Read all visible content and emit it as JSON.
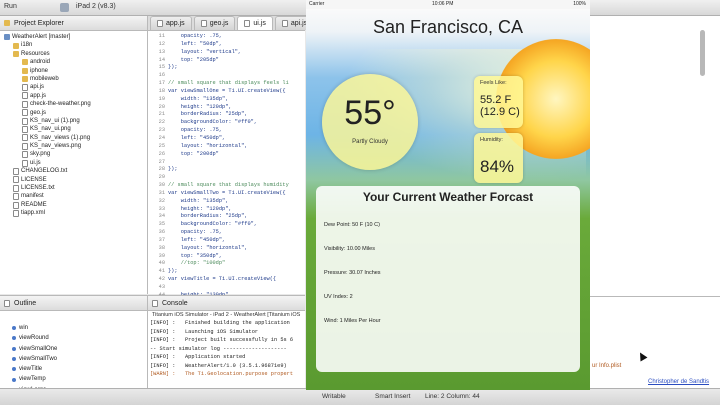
{
  "toolbar": {
    "run_label": "Run",
    "device_label": "iPad 2 (v8.3)"
  },
  "explorer": {
    "title": "Project Explorer",
    "items": [
      {
        "label": "WeatherAlert [master]",
        "icon": "project-icon",
        "indent": 0
      },
      {
        "label": "i18n",
        "icon": "folder-icon",
        "indent": 1
      },
      {
        "label": "Resources",
        "icon": "folder-icon",
        "indent": 1
      },
      {
        "label": "android",
        "icon": "folder-icon",
        "indent": 2
      },
      {
        "label": "iphone",
        "icon": "folder-icon",
        "indent": 2
      },
      {
        "label": "mobileweb",
        "icon": "folder-icon",
        "indent": 2
      },
      {
        "label": "api.js",
        "icon": "file-icon",
        "indent": 2
      },
      {
        "label": "app.js",
        "icon": "file-icon",
        "indent": 2
      },
      {
        "label": "check-the-weather.png",
        "icon": "file-icon",
        "indent": 2
      },
      {
        "label": "geo.js",
        "icon": "file-icon",
        "indent": 2
      },
      {
        "label": "KS_nav_ui (1).png",
        "icon": "file-icon",
        "indent": 2
      },
      {
        "label": "KS_nav_ui.png",
        "icon": "file-icon",
        "indent": 2
      },
      {
        "label": "KS_nav_views (1).png",
        "icon": "file-icon",
        "indent": 2
      },
      {
        "label": "KS_nav_views.png",
        "icon": "file-icon",
        "indent": 2
      },
      {
        "label": "sky.png",
        "icon": "file-icon",
        "indent": 2
      },
      {
        "label": "ui.js",
        "icon": "file-icon",
        "indent": 2
      },
      {
        "label": "CHANGELOG.txt",
        "icon": "file-icon",
        "indent": 1
      },
      {
        "label": "LICENSE",
        "icon": "file-icon",
        "indent": 1
      },
      {
        "label": "LICENSE.txt",
        "icon": "file-icon",
        "indent": 1
      },
      {
        "label": "manifest",
        "icon": "file-icon",
        "indent": 1
      },
      {
        "label": "README",
        "icon": "file-icon",
        "indent": 1
      },
      {
        "label": "tiapp.xml",
        "icon": "file-icon",
        "indent": 1
      }
    ]
  },
  "editor": {
    "tabs": [
      {
        "label": "app.js",
        "active": false
      },
      {
        "label": "geo.js",
        "active": false
      },
      {
        "label": "ui.js",
        "active": true
      },
      {
        "label": "api.js",
        "active": false
      }
    ],
    "lines": [
      {
        "n": "11",
        "t": "    opacity: .75,",
        "k": ""
      },
      {
        "n": "12",
        "t": "    left: \"50dp\",",
        "k": ""
      },
      {
        "n": "13",
        "t": "    layout: \"vertical\",",
        "k": ""
      },
      {
        "n": "14",
        "t": "    top: \"205dp\"",
        "k": ""
      },
      {
        "n": "15",
        "t": "});",
        "k": ""
      },
      {
        "n": "16",
        "t": "",
        "k": ""
      },
      {
        "n": "17",
        "t": "// small square that displays feels li",
        "k": "comment"
      },
      {
        "n": "18",
        "t": "var viewSmallOne = Ti.UI.createView({",
        "k": ""
      },
      {
        "n": "19",
        "t": "    width: \"135dp\",",
        "k": ""
      },
      {
        "n": "20",
        "t": "    height: \"120dp\",",
        "k": ""
      },
      {
        "n": "21",
        "t": "    borderRadius: \"25dp\",",
        "k": ""
      },
      {
        "n": "22",
        "t": "    backgroundColor: \"#ff0\",",
        "k": ""
      },
      {
        "n": "23",
        "t": "    opacity: .75,",
        "k": ""
      },
      {
        "n": "24",
        "t": "    left: \"450dp\",",
        "k": ""
      },
      {
        "n": "25",
        "t": "    layout: \"horizontal\",",
        "k": ""
      },
      {
        "n": "26",
        "t": "    top: \"200dp\"",
        "k": ""
      },
      {
        "n": "27",
        "t": "",
        "k": ""
      },
      {
        "n": "28",
        "t": "});",
        "k": ""
      },
      {
        "n": "29",
        "t": "",
        "k": ""
      },
      {
        "n": "30",
        "t": "// small square that displays humidity",
        "k": "comment"
      },
      {
        "n": "31",
        "t": "var viewSmallTwo = Ti.UI.createView({",
        "k": ""
      },
      {
        "n": "32",
        "t": "    width: \"135dp\",",
        "k": ""
      },
      {
        "n": "33",
        "t": "    height: \"120dp\",",
        "k": ""
      },
      {
        "n": "34",
        "t": "    borderRadius: \"25dp\",",
        "k": ""
      },
      {
        "n": "35",
        "t": "    backgroundColor: \"#ff0\",",
        "k": ""
      },
      {
        "n": "36",
        "t": "    opacity: .75,",
        "k": ""
      },
      {
        "n": "37",
        "t": "    left: \"450dp\",",
        "k": ""
      },
      {
        "n": "38",
        "t": "    layout: \"horizontal\",",
        "k": ""
      },
      {
        "n": "39",
        "t": "    top: \"350dp\",",
        "k": ""
      },
      {
        "n": "40",
        "t": "    //top: \"100dp\"",
        "k": "comment"
      },
      {
        "n": "41",
        "t": "});",
        "k": ""
      },
      {
        "n": "42",
        "t": "var viewTitle = Ti.UI.createView({",
        "k": ""
      },
      {
        "n": "43",
        "t": "",
        "k": ""
      },
      {
        "n": "44",
        "t": "    height: \"130dp\",",
        "k": ""
      }
    ]
  },
  "outline": {
    "title": "Outline",
    "items": [
      "win",
      "viewRound",
      "viewSmallOne",
      "viewSmallTwo",
      "viewTitle",
      "viewTemp",
      "viewLarge"
    ]
  },
  "console": {
    "title": "Console",
    "subtitle": "Titanium iOS Simulator - iPad 2 - WeatherAlert [Titanium iOS",
    "lines": [
      {
        "t": "[INFO] :   Finished building the application",
        "k": ""
      },
      {
        "t": "[INFO] :   Launching iOS Simulator",
        "k": ""
      },
      {
        "t": "[INFO] :   Project built successfully in 5s 6",
        "k": ""
      },
      {
        "t": "-- Start simulator log --------------------",
        "k": ""
      },
      {
        "t": "[INFO] :   Application started",
        "k": ""
      },
      {
        "t": "[INFO] :   WeatherAlert/1.0 (3.5.1.96871e9)",
        "k": ""
      },
      {
        "t": "[WARN] :   The Ti.Geolocation.purpose propert",
        "k": "warn"
      }
    ],
    "right_tail": "ur Info.plist",
    "author": "Christopher de Sandtis"
  },
  "statusbar": {
    "writable": "Writable",
    "insert": "Smart Insert",
    "position": "Line: 2 Column: 44"
  },
  "simulator": {
    "carrier": "Carrier",
    "time": "10:06 PM",
    "battery": "100%",
    "city": "San Francisco, CA",
    "temperature": "55°",
    "condition": "Partly Cloudy",
    "feels_label": "Feels Like:",
    "feels_f": "55.2 F",
    "feels_c": "(12.9 C)",
    "humidity_label": "Humidity:",
    "humidity": "84%",
    "forecast_title": "Your Current Weather Forcast",
    "forecast": [
      "Dew Point: 50 F (10 C)",
      "Visibility: 10.00 Miles",
      "Pressure: 30.07 Inches",
      "UV Index: 2",
      "Wind: 1 Miles Per Hour"
    ]
  }
}
